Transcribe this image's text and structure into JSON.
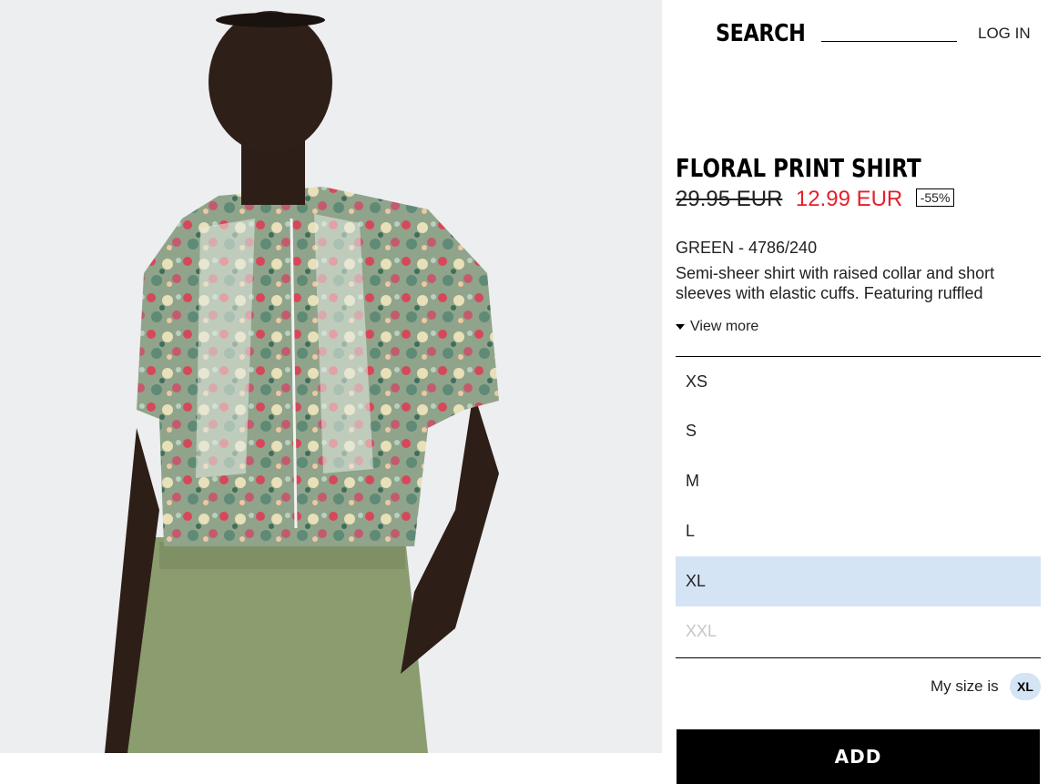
{
  "header": {
    "search_label": "SEARCH",
    "login_label": "LOG IN"
  },
  "product": {
    "title": "FLORAL PRINT SHIRT",
    "old_price": "29.95 EUR",
    "new_price": "12.99 EUR",
    "discount": "-55%",
    "color_ref": "GREEN - 4786/240",
    "description": "Semi-sheer shirt with raised collar and short sleeves with elastic cuffs. Featuring ruffled",
    "view_more": "View more"
  },
  "sizes": [
    {
      "label": "XS",
      "state": "available"
    },
    {
      "label": "S",
      "state": "available"
    },
    {
      "label": "M",
      "state": "available"
    },
    {
      "label": "L",
      "state": "available"
    },
    {
      "label": "XL",
      "state": "selected"
    },
    {
      "label": "XXL",
      "state": "unavailable"
    }
  ],
  "my_size": {
    "label": "My size is",
    "value": "XL"
  },
  "add_button": {
    "label": "ADD"
  },
  "colors": {
    "sale_red": "#e5202a",
    "selected_bg": "#d5e4f5",
    "disabled_text": "#c6c6c6"
  }
}
